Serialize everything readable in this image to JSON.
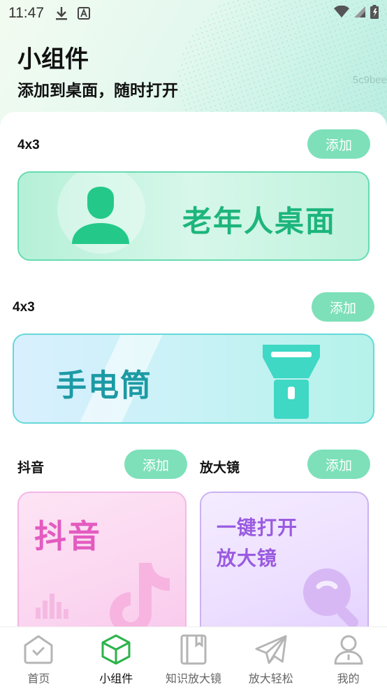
{
  "status_bar": {
    "time": "11:47"
  },
  "header": {
    "title": "小组件",
    "subtitle": "添加到桌面，随时打开",
    "watermark": "5c9bee"
  },
  "widgets": [
    {
      "label": "4x3",
      "add_label": "添加",
      "card_text": "老年人桌面",
      "color": "#1db57c"
    },
    {
      "label": "4x3",
      "add_label": "添加",
      "card_text": "手电筒",
      "color": "#1c9aa4"
    },
    {
      "label": "抖音",
      "add_label": "添加",
      "card_text": "抖音",
      "color": "#e35bc0"
    },
    {
      "label": "放大镜",
      "add_label": "添加",
      "card_text_line1": "一键打开",
      "card_text_line2": "放大镜",
      "color": "#9a5be0"
    }
  ],
  "accent": "#7de0b9",
  "bottom_nav": [
    {
      "label": "首页",
      "icon": "home-icon",
      "active": false
    },
    {
      "label": "小组件",
      "icon": "widget-cube-icon",
      "active": true
    },
    {
      "label": "知识放大镜",
      "icon": "book-icon",
      "active": false
    },
    {
      "label": "放大轻松",
      "icon": "paper-plane-icon",
      "active": false
    },
    {
      "label": "我的",
      "icon": "user-icon",
      "active": false
    }
  ]
}
